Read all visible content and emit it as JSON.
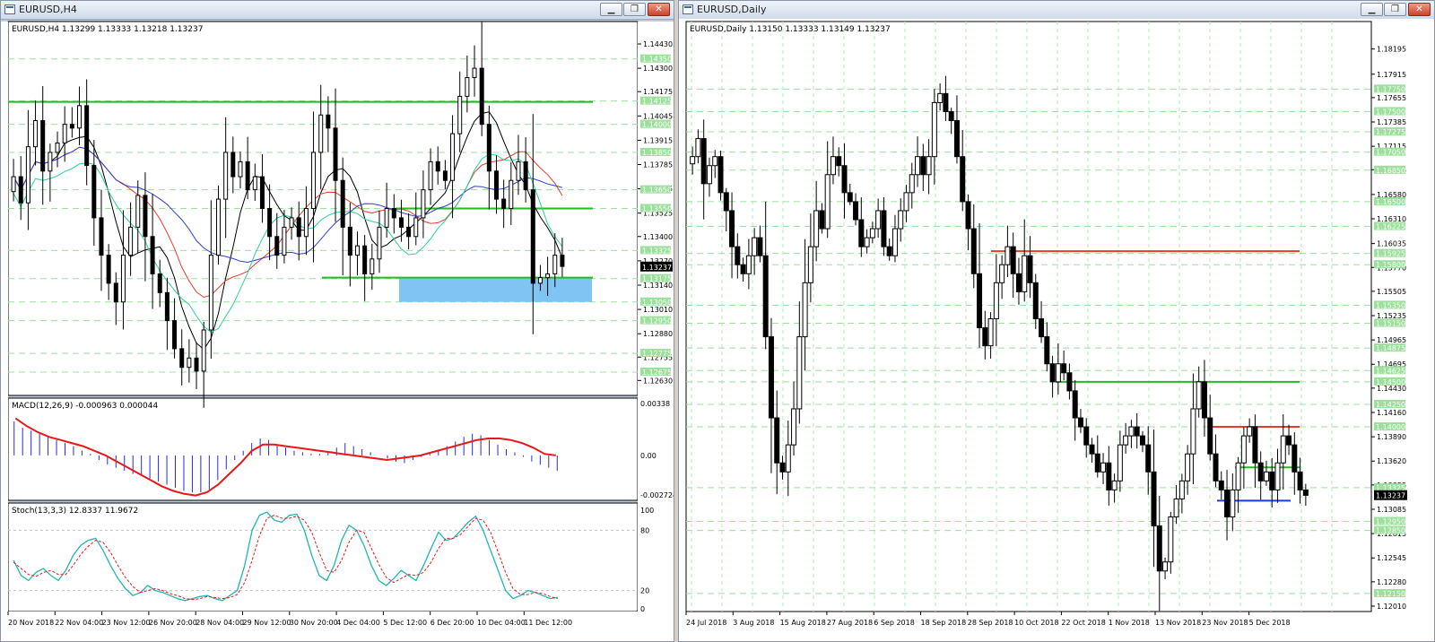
{
  "windows": [
    {
      "title": "EURUSD,H4",
      "minimize_glyph": "▁",
      "restore_glyph": "❐",
      "close_glyph": "✕"
    },
    {
      "title": "EURUSD,Daily",
      "minimize_glyph": "▁",
      "restore_glyph": "❐",
      "close_glyph": "✕"
    }
  ],
  "chart_data": [
    {
      "type": "line",
      "chart_kind": "candlestick",
      "title": "EURUSD,H4  1.13299 1.13333 1.13218 1.13237",
      "ylim": [
        1.1255,
        1.1455
      ],
      "y_ticks": [
        "1.14430",
        "1.14300",
        "1.14175",
        "1.14045",
        "1.13915",
        "1.13785",
        "1.13655",
        "1.13525",
        "1.13400",
        "1.13270",
        "1.13140",
        "1.13010",
        "1.12880",
        "1.12755",
        "1.12630"
      ],
      "level_labels": [
        "1.14350",
        "1.14125",
        "1.14000",
        "1.13850",
        "1.13650",
        "1.13550",
        "1.13325",
        "1.13175",
        "1.13050",
        "1.12950",
        "1.12775",
        "1.12675"
      ],
      "current_price": "1.13237",
      "x_labels": [
        "20 Nov 2018",
        "22 Nov 04:00",
        "23 Nov 12:00",
        "26 Nov 20:00",
        "28 Nov 04:00",
        "29 Nov 12:00",
        "30 Nov 20:00",
        "4 Dec 04:00",
        "5 Dec 12:00",
        "6 Dec 20:00",
        "10 Dec 04:00",
        "11 Dec 12:00"
      ],
      "horizontal_lines": [
        {
          "color": "#22bb22",
          "value": 1.1412
        },
        {
          "color": "#22bb22",
          "value": 1.1355
        },
        {
          "color": "#22bb22",
          "value": 1.1318
        }
      ],
      "zone": {
        "from": 1.1305,
        "to": 1.1318,
        "color": "#80c4f4"
      },
      "series": [
        {
          "values": [
            1.1372,
            1.1358,
            1.1388,
            1.1402,
            1.1375,
            1.1385,
            1.139,
            1.14,
            1.1398,
            1.141,
            1.1378,
            1.135,
            1.133,
            1.1315,
            1.1305,
            1.133,
            1.1345,
            1.1362,
            1.134,
            1.132,
            1.131,
            1.1295,
            1.128,
            1.127,
            1.1275,
            1.1268,
            1.129,
            1.133,
            1.136,
            1.1385,
            1.1372,
            1.138,
            1.1365,
            1.1372,
            1.1355,
            1.134,
            1.133,
            1.1345,
            1.135,
            1.134,
            1.1355,
            1.1385,
            1.1405,
            1.1398,
            1.137,
            1.1345,
            1.133,
            1.1335,
            1.132,
            1.1328,
            1.1345,
            1.1355,
            1.135,
            1.1345,
            1.134,
            1.135,
            1.1365,
            1.138,
            1.1375,
            1.137,
            1.1395,
            1.1415,
            1.1425,
            1.143,
            1.14,
            1.1375,
            1.136,
            1.1355,
            1.137,
            1.138,
            1.1365,
            1.1315,
            1.1318,
            1.132,
            1.133,
            1.1324
          ]
        }
      ]
    },
    {
      "type": "line",
      "chart_kind": "macd",
      "title": "MACD(12,26,9) -0.000963 0.000044",
      "ylim": [
        -0.0028,
        0.0036
      ],
      "y_ticks": [
        "0.00338",
        "0.00",
        "-0.002724"
      ],
      "series": [
        {
          "name": "histogram",
          "values": [
            0.0022,
            0.0018,
            0.0016,
            0.0014,
            0.0012,
            0.001,
            0.0008,
            0.0006,
            0.0003,
            0.0001,
            -0.0003,
            -0.0006,
            -0.0008,
            -0.001,
            -0.0012,
            -0.0013,
            -0.0015,
            -0.0017,
            -0.0019,
            -0.0021,
            -0.0023,
            -0.0024,
            -0.0024,
            -0.0022,
            -0.0016,
            -0.0009,
            -0.0003,
            0.0003,
            0.0008,
            0.0011,
            0.001,
            0.0007,
            0.0005,
            0.0003,
            0.0002,
            0.0001,
            0.0001,
            0.0002,
            0.0005,
            0.0008,
            0.0006,
            0.0004,
            0.0002,
            0.0,
            -0.0002,
            -0.0004,
            -0.0005,
            -0.0003,
            -0.0001,
            0.0001,
            0.0003,
            0.0006,
            0.0009,
            0.0012,
            0.0014,
            0.0013,
            0.001,
            0.0007,
            0.0004,
            0.0002,
            -0.0001,
            -0.0004,
            -0.0006,
            -0.0008,
            -0.001
          ]
        },
        {
          "name": "signal",
          "values": [
            0.0024,
            0.0019,
            0.0015,
            0.0012,
            0.001,
            0.0008,
            0.0006,
            0.0003,
            0.0,
            -0.0004,
            -0.0008,
            -0.0012,
            -0.0016,
            -0.002,
            -0.0023,
            -0.0025,
            -0.0026,
            -0.0024,
            -0.0019,
            -0.0012,
            -0.0005,
            0.0003,
            0.0007,
            0.0007,
            0.0006,
            0.0005,
            0.0004,
            0.0003,
            0.0002,
            0.0001,
            0.0,
            -0.0001,
            -0.0002,
            -0.0003,
            -0.0002,
            -0.0001,
            0.0,
            0.0002,
            0.0004,
            0.0006,
            0.0008,
            0.001,
            0.0011,
            0.0011,
            0.001,
            0.0008,
            0.0005,
            0.0001,
            0.0
          ]
        }
      ]
    },
    {
      "type": "line",
      "chart_kind": "stochastic",
      "title": "Stoch(13,3,3) 12.8337 11.9672",
      "ylim": [
        0,
        100
      ],
      "y_ticks": [
        "100",
        "80",
        "20",
        "0"
      ],
      "series": [
        {
          "name": "main",
          "values": [
            50,
            35,
            30,
            38,
            42,
            35,
            30,
            40,
            55,
            65,
            70,
            72,
            60,
            45,
            32,
            22,
            15,
            18,
            25,
            20,
            18,
            15,
            12,
            10,
            12,
            14,
            15,
            12,
            10,
            15,
            20,
            45,
            80,
            95,
            98,
            90,
            88,
            95,
            96,
            80,
            55,
            35,
            30,
            45,
            70,
            85,
            80,
            65,
            45,
            30,
            25,
            32,
            40,
            35,
            30,
            45,
            62,
            78,
            70,
            72,
            80,
            88,
            94,
            80,
            60,
            40,
            20,
            12,
            15,
            20,
            18,
            15,
            12,
            13
          ]
        },
        {
          "name": "signal",
          "values": [
            48,
            42,
            36,
            34,
            38,
            40,
            36,
            36,
            45,
            56,
            64,
            70,
            68,
            58,
            45,
            33,
            24,
            18,
            20,
            22,
            20,
            17,
            15,
            12,
            11,
            12,
            14,
            13,
            12,
            13,
            16,
            28,
            50,
            75,
            92,
            95,
            92,
            92,
            94,
            90,
            78,
            58,
            40,
            38,
            50,
            68,
            80,
            78,
            62,
            46,
            33,
            28,
            32,
            36,
            35,
            38,
            48,
            62,
            72,
            72,
            76,
            84,
            92,
            90,
            78,
            58,
            38,
            22,
            16,
            16,
            18,
            17,
            14,
            12
          ]
        }
      ]
    },
    {
      "type": "line",
      "chart_kind": "candlestick",
      "title": "EURUSD,Daily  1.13150 1.13333 1.13149 1.13237",
      "ylim": [
        1.1195,
        1.185
      ],
      "y_ticks": [
        "1.18195",
        "1.17915",
        "1.17655",
        "1.17385",
        "1.17115",
        "1.16855",
        "1.16580",
        "1.16310",
        "1.16035",
        "1.15770",
        "1.15505",
        "1.15235",
        "1.14965",
        "1.14695",
        "1.14430",
        "1.14160",
        "1.13890",
        "1.13620",
        "1.13355",
        "1.13085",
        "1.12815",
        "1.12545",
        "1.12280",
        "1.12010"
      ],
      "level_labels": [
        "1.17750",
        "1.17500",
        "1.17275",
        "1.17050",
        "1.16850",
        "1.16500",
        "1.16225",
        "1.15925",
        "1.15800",
        "1.15350",
        "1.15150",
        "1.14875",
        "1.14625",
        "1.14500",
        "1.14250",
        "1.14000",
        "1.13325",
        "1.12950",
        "1.12850",
        "1.12150"
      ],
      "current_price": "1.13237",
      "x_labels": [
        "24 Jul 2018",
        "3 Aug 2018",
        "15 Aug 2018",
        "27 Aug 2018",
        "6 Sep 2018",
        "18 Sep 2018",
        "28 Sep 2018",
        "10 Oct 2018",
        "22 Oct 2018",
        "1 Nov 2018",
        "13 Nov 2018",
        "23 Nov 2018",
        "5 Dec 2018"
      ],
      "horizontal_lines": [
        {
          "color": "#e83b2b",
          "value": 1.1595
        },
        {
          "color": "#22bb22",
          "value": 1.145
        },
        {
          "color": "#e83b2b",
          "value": 1.14
        },
        {
          "color": "#22bb22",
          "value": 1.1355
        },
        {
          "color": "#1c3be6",
          "value": 1.1318
        }
      ],
      "series": [
        {
          "values": [
            1.17,
            1.172,
            1.167,
            1.169,
            1.17,
            1.166,
            1.164,
            1.16,
            1.158,
            1.157,
            1.159,
            1.161,
            1.159,
            1.15,
            1.141,
            1.136,
            1.135,
            1.138,
            1.142,
            1.15,
            1.156,
            1.16,
            1.164,
            1.162,
            1.168,
            1.17,
            1.169,
            1.166,
            1.165,
            1.163,
            1.16,
            1.161,
            1.162,
            1.164,
            1.16,
            1.159,
            1.162,
            1.164,
            1.166,
            1.168,
            1.17,
            1.168,
            1.17,
            1.176,
            1.177,
            1.175,
            1.174,
            1.17,
            1.165,
            1.162,
            1.157,
            1.151,
            1.149,
            1.152,
            1.156,
            1.158,
            1.16,
            1.157,
            1.155,
            1.159,
            1.156,
            1.152,
            1.15,
            1.147,
            1.145,
            1.147,
            1.146,
            1.144,
            1.141,
            1.14,
            1.138,
            1.137,
            1.135,
            1.136,
            1.133,
            1.134,
            1.138,
            1.139,
            1.14,
            1.139,
            1.138,
            1.135,
            1.129,
            1.124,
            1.125,
            1.13,
            1.132,
            1.134,
            1.137,
            1.142,
            1.145,
            1.141,
            1.137,
            1.134,
            1.133,
            1.13,
            1.133,
            1.136,
            1.139,
            1.14,
            1.136,
            1.134,
            1.135,
            1.133,
            1.136,
            1.139,
            1.138,
            1.135,
            1.133,
            1.1324
          ]
        }
      ]
    }
  ]
}
